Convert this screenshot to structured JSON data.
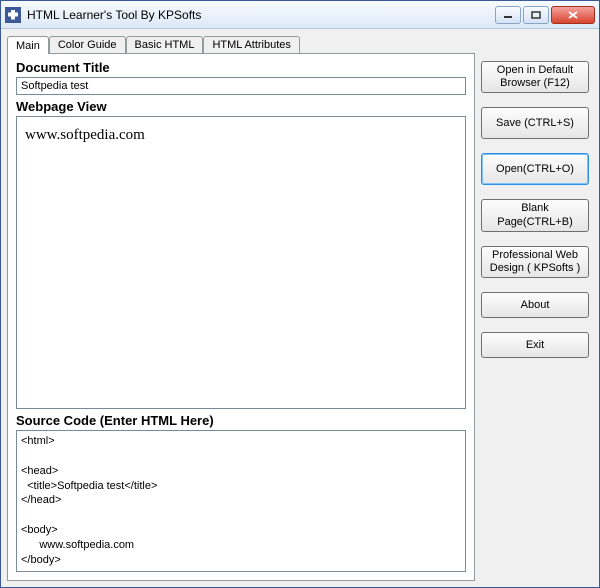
{
  "window": {
    "title": "HTML Learner's Tool By KPSofts"
  },
  "tabs": [
    {
      "label": "Main"
    },
    {
      "label": "Color Guide"
    },
    {
      "label": "Basic HTML"
    },
    {
      "label": "HTML Attributes"
    }
  ],
  "main": {
    "doc_title_label": "Document Title",
    "doc_title_value": "Softpedia test",
    "webpage_view_label": "Webpage View",
    "webpage_content": "www.softpedia.com",
    "source_label": "Source Code (Enter HTML Here)",
    "source_value": "<html>\n\n<head>\n  <title>Softpedia test</title>\n</head>\n\n<body>\n      www.softpedia.com\n</body>\n\n</html>"
  },
  "buttons": {
    "open_browser": "Open in Default Browser (F12)",
    "save": "Save (CTRL+S)",
    "open": "Open(CTRL+O)",
    "blank": "Blank Page(CTRL+B)",
    "pro": "Professional Web Design ( KPSofts )",
    "about": "About",
    "exit": "Exit"
  }
}
